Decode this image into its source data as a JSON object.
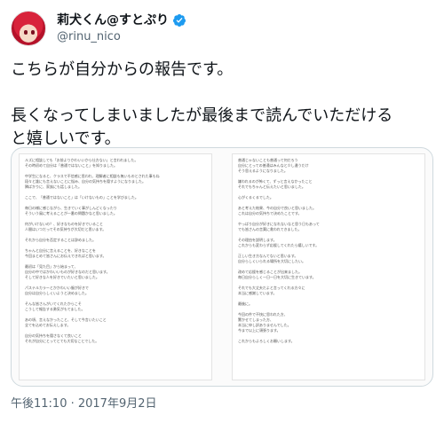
{
  "user": {
    "display_name": "莉犬くん@すとぷり",
    "handle": "@rinu_nico",
    "avatar_icon": "avatar-image",
    "verified_icon": "verified-badge-icon",
    "verified_color": "#1d9bf0"
  },
  "tweet": {
    "text": "こちらが自分からの報告です。\n\n長くなってしまいましたが最後まで読んでいただける\nと嬉しいです。",
    "timestamp": "午後11:10 · 2017年9月2日"
  },
  "media": {
    "left_page_lines": [
      "ルズに相談しても「お前よりかわいいから仕方ない」と言われました。",
      "その時初めて自分は「普通ではないこと」を知りました。",
      "",
      "中学生になると、クラスで不信感に思われ、理解者に相談も無いものとされた事もね",
      "段々と誰にも言えないことに悩み、自分の気持ちを隠すようになりました。",
      "隣ばかりに、家族にも話しました。",
      "",
      "ここで、「普通ではないこと」は「いけないもの」ことを学びました。",
      "",
      "毎日の様に感じながら、生きていく事がしんどくなったり",
      "そういう風に考えることが一番の問題かなと思いました。",
      "",
      "何がいけないの？、好きなものを好きでいること",
      "人間はいつだってその気持ちが大切だと思います。",
      "",
      "それから自分を否定することは辞めました。",
      "",
      "ちゃんと自分に言えることを、好きなことを",
      "今回まとめて皆さんにお伝えできればと思います。",
      "",
      "最初は「見た目」から始まって、",
      "自分の中ではかわいいものが好きなのだと思います。",
      "そして好きな人を好きでいたいと思いました。",
      "",
      "パステルカラーとかかわいい服が好きで",
      "自分は自分らしくいようと決めました。",
      "",
      "そんな皆さんがいてくれたからこそ",
      "こうして報告する勇気がもてました。",
      "",
      "あの頃、言えなかったこと、そして今言いたいこと",
      "全てを込めてお伝えします。",
      "",
      "自分の気持ちを隠さなくて良いこと",
      "それが自分にとってとても大切なことでした。"
    ],
    "right_page_lines": [
      "普通じゃないことも普通って何だろう",
      "自分にとっての普通はみんなと少し違うだけ",
      "そう思えるようになりました。",
      "",
      "嫌われるのが怖くて、ずっと言えなかったこと",
      "それでもちゃんと伝えたいと思いました。",
      "",
      "心がくるくるでした。",
      "",
      "あと考えた結果、今の自分で良いと思いました。",
      "これは自分の気持ちで決めたことです。",
      "",
      "やっぱり自分が好きになれないなと思う日もあって",
      "でも皆さんの言葉に救われてきました。",
      "",
      "その理由を説明します。",
      "これからも変わらず応援してくれたら嬉しいです。",
      "",
      "正しい生き方なんてないと思います。",
      "自分らしくいられる場所を大切にしたい。",
      "",
      "改めて応援を感じることが出来ました。",
      "毎日自分らしく一日一日を大切に生きています。",
      "",
      "それでも大丈夫だよと言ってくれる方々に",
      "本当に感謝しています。",
      "",
      "最後に。",
      "",
      "今回の件で不快に思われた方、",
      "驚かせてしまった方、",
      "本当に申し訳ありませんでした。",
      "今まで以上に頑張ります。",
      "",
      "これからもよろしくお願いします。"
    ]
  }
}
